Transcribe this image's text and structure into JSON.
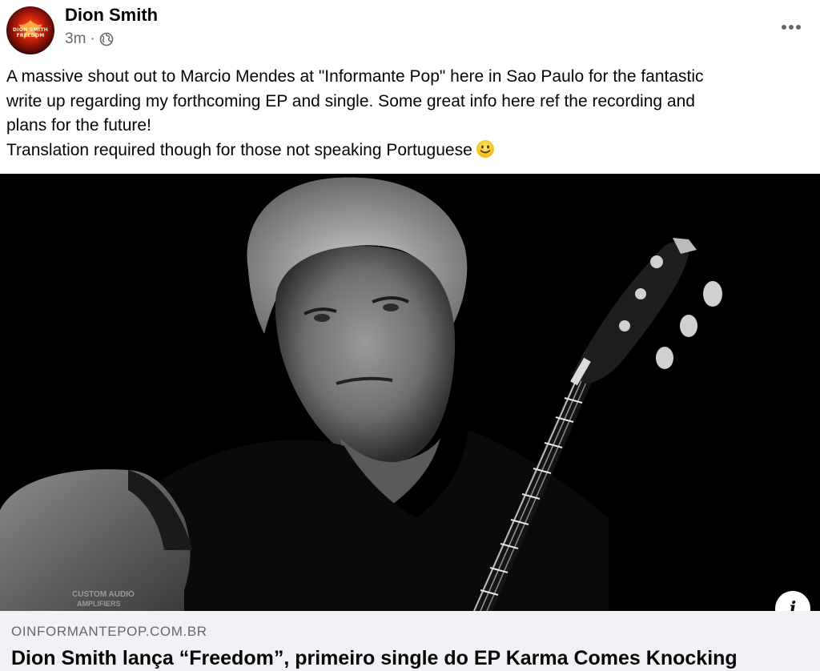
{
  "post": {
    "author": "Dion Smith",
    "time": "3m",
    "separator": "·",
    "privacy_icon": "globe-icon",
    "more_icon": "more-horizontal-icon",
    "avatar_logo_text": "DION SMITH FREEDOM",
    "text_lines": [
      "A massive shout out to Marcio Mendes at \"Informante Pop\" here in Sao Paulo for the fantastic",
      "write up regarding my forthcoming EP and single.  Some great info here ref the recording and",
      "plans for the future!",
      "Translation required though for those not speaking Portuguese"
    ],
    "emoji": "slightly-smiling-face-icon"
  },
  "photo": {
    "amp_text_line1": "CUSTOM AUDIO",
    "amp_text_line2": "AMPLIFIERS"
  },
  "link": {
    "domain": "OINFORMANTEPOP.COM.BR",
    "title": "Dion Smith lança “Freedom”, primeiro single do EP Karma Comes Knocking",
    "info_label": "i"
  },
  "colors": {
    "text_primary": "#050505",
    "text_secondary": "#65676b",
    "link_bg": "#f0f2f5",
    "avatar_accent": "#c81e0a"
  }
}
